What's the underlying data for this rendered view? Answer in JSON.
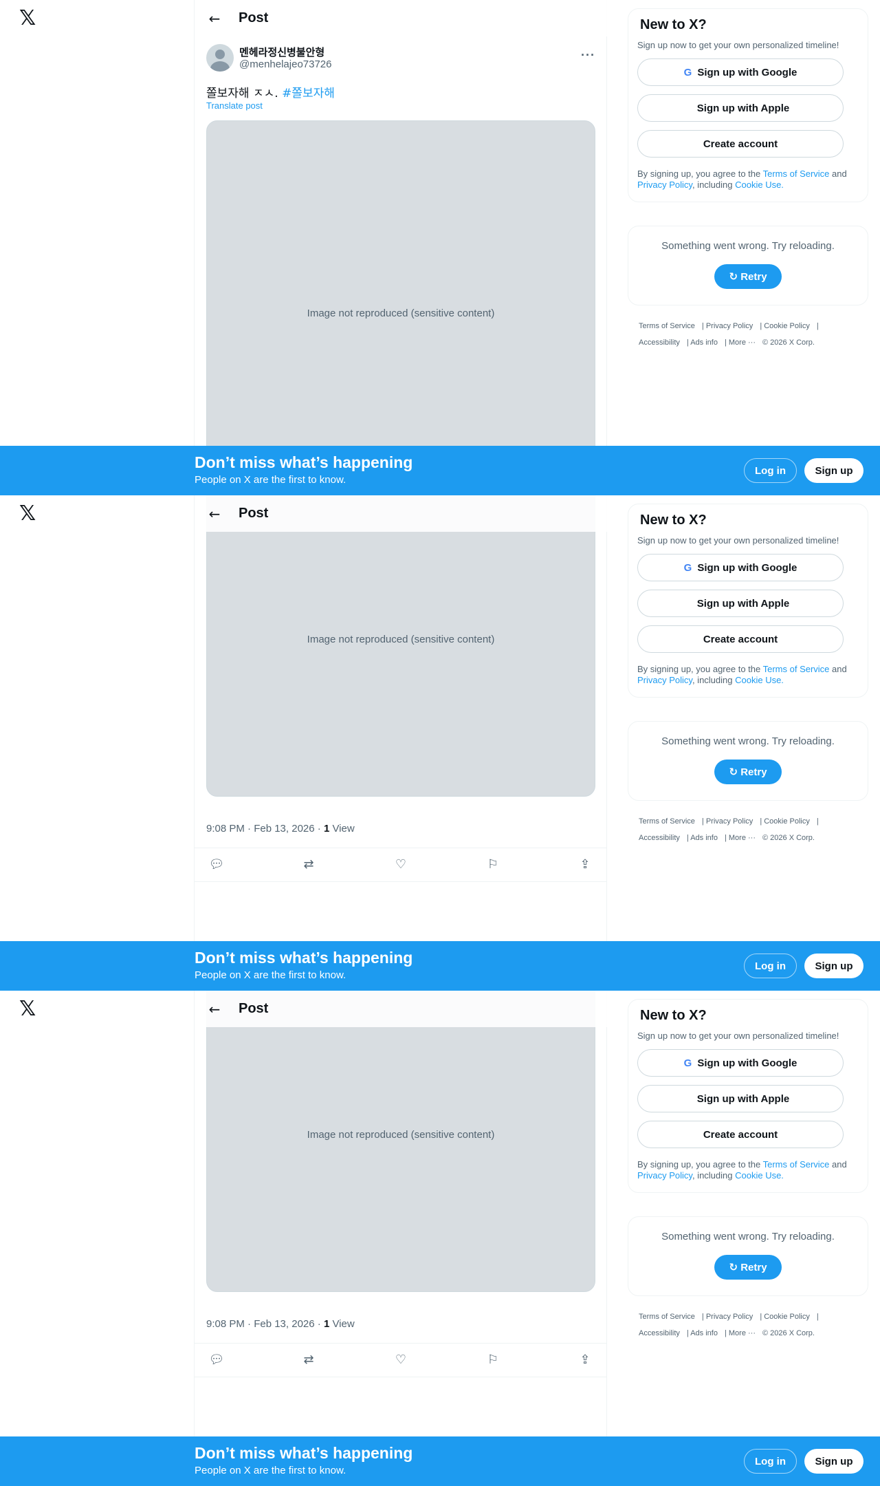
{
  "nav": {
    "logo": "𝕏",
    "back": "←",
    "title": "Post"
  },
  "post": {
    "author_name": "멘헤라정신병불안형",
    "handle": "@menhelajeo73726",
    "more": "···",
    "text": "쫄보자해 ㅈㅅ.",
    "hashtag": "#쫄보자해",
    "translate": "Translate post",
    "media_note": "Image not reproduced (sensitive content)",
    "timestamp": "9:08 PM · Feb 13, 2026 · ",
    "views_count": "1",
    "views_label": " View"
  },
  "sidebar": {
    "heading": "New to X?",
    "subtitle": "Sign up now to get your own personalized timeline!",
    "google_label": "Sign up with Google",
    "apple_label": "Sign up with Apple",
    "create_label": "Create account",
    "legal_prefix": "By signing up, you agree to the ",
    "terms": "Terms of Service",
    "and": " and ",
    "privacy": "Privacy Policy",
    "including": ", including ",
    "cookie": "Cookie Use.",
    "error_msg": "Something went wrong. Try reloading.",
    "retry": "Retry"
  },
  "footer": {
    "links": [
      "Terms of Service",
      "Privacy Policy",
      "Cookie Policy",
      "Accessibility",
      "Ads info",
      "More ···",
      "© 2026 X Corp."
    ]
  },
  "banner": {
    "title": "Don’t miss what’s happening",
    "subtitle": "People on X are the first to know.",
    "login": "Log in",
    "signup": "Sign up"
  },
  "colors": {
    "accent": "#1d9bf0",
    "text": "#0f1419",
    "muted": "#536471"
  }
}
